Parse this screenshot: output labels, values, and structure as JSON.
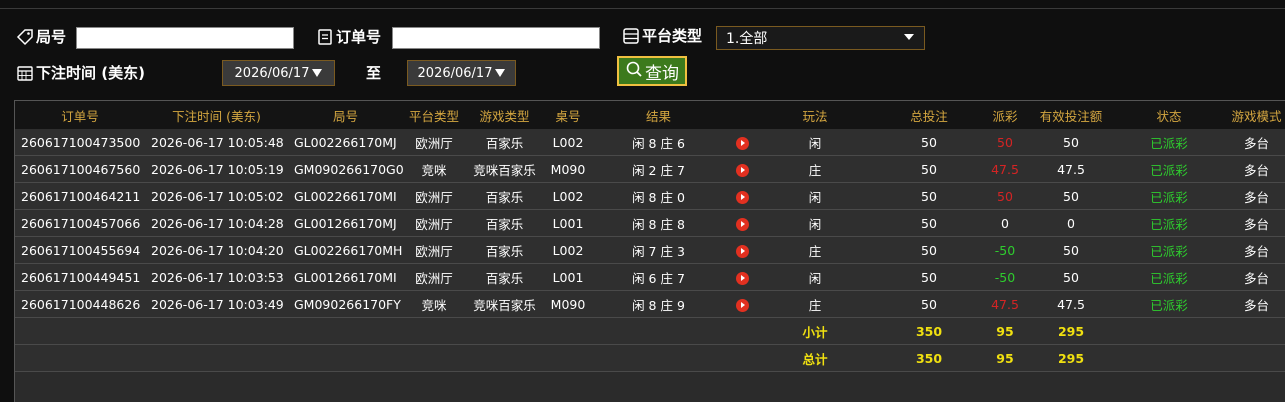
{
  "filters": {
    "ju_label": "局号",
    "ju_value": "",
    "order_label": "订单号",
    "order_value": "",
    "platform_label": "平台类型",
    "platform_selected": "1.全部",
    "bet_time_label": "下注时间 (美东)",
    "date_from": "2026/06/17",
    "to_label": "至",
    "date_to": "2026/06/17",
    "query_label": "查询"
  },
  "table": {
    "headers": [
      "订单号",
      "下注时间 (美东)",
      "局号",
      "平台类型",
      "游戏类型",
      "桌号",
      "结果",
      "",
      "玩法",
      "总投注",
      "派彩",
      "有效投注额",
      "状态",
      "游戏模式"
    ],
    "rows": [
      {
        "order": "260617100473500",
        "time": "2026-06-17 10:05:48",
        "ju": "GL002266170MJ",
        "platform": "欧洲厅",
        "game": "百家乐",
        "table_no": "L002",
        "result": "闲 8 庄 6",
        "play": "闲",
        "bet": "50",
        "payout": "50",
        "payout_color": "red",
        "valid": "50",
        "status": "已派彩",
        "mode": "多台"
      },
      {
        "order": "260617100467560",
        "time": "2026-06-17 10:05:19",
        "ju": "GM090266170G0",
        "platform": "竞咪",
        "game": "竞咪百家乐",
        "table_no": "M090",
        "result": "闲 2 庄 7",
        "play": "庄",
        "bet": "50",
        "payout": "47.5",
        "payout_color": "red",
        "valid": "47.5",
        "status": "已派彩",
        "mode": "多台"
      },
      {
        "order": "260617100464211",
        "time": "2026-06-17 10:05:02",
        "ju": "GL002266170MI",
        "platform": "欧洲厅",
        "game": "百家乐",
        "table_no": "L002",
        "result": "闲 8 庄 0",
        "play": "闲",
        "bet": "50",
        "payout": "50",
        "payout_color": "red",
        "valid": "50",
        "status": "已派彩",
        "mode": "多台"
      },
      {
        "order": "260617100457066",
        "time": "2026-06-17 10:04:28",
        "ju": "GL001266170MJ",
        "platform": "欧洲厅",
        "game": "百家乐",
        "table_no": "L001",
        "result": "闲 8 庄 8",
        "play": "闲",
        "bet": "50",
        "payout": "0",
        "payout_color": "white",
        "valid": "0",
        "status": "已派彩",
        "mode": "多台"
      },
      {
        "order": "260617100455694",
        "time": "2026-06-17 10:04:20",
        "ju": "GL002266170MH",
        "platform": "欧洲厅",
        "game": "百家乐",
        "table_no": "L002",
        "result": "闲 7 庄 3",
        "play": "庄",
        "bet": "50",
        "payout": "-50",
        "payout_color": "green",
        "valid": "50",
        "status": "已派彩",
        "mode": "多台"
      },
      {
        "order": "260617100449451",
        "time": "2026-06-17 10:03:53",
        "ju": "GL001266170MI",
        "platform": "欧洲厅",
        "game": "百家乐",
        "table_no": "L001",
        "result": "闲 6 庄 7",
        "play": "闲",
        "bet": "50",
        "payout": "-50",
        "payout_color": "green",
        "valid": "50",
        "status": "已派彩",
        "mode": "多台"
      },
      {
        "order": "260617100448626",
        "time": "2026-06-17 10:03:49",
        "ju": "GM090266170FY",
        "platform": "竞咪",
        "game": "竞咪百家乐",
        "table_no": "M090",
        "result": "闲 8 庄 9",
        "play": "庄",
        "bet": "50",
        "payout": "47.5",
        "payout_color": "red",
        "valid": "47.5",
        "status": "已派彩",
        "mode": "多台"
      }
    ],
    "subtotal": {
      "label": "小计",
      "bet": "350",
      "payout": "95",
      "valid": "295"
    },
    "total": {
      "label": "总计",
      "bet": "350",
      "payout": "95",
      "valid": "295"
    }
  },
  "colors": {
    "header_text": "#d4a640",
    "payout_red": "#d42424",
    "payout_green": "#2ecc2e",
    "status_green": "#2ecc2e",
    "sum_yellow": "#f0e010",
    "query_bg": "#3c7a1c",
    "query_border": "#f0c040"
  },
  "icons": [
    "tag-icon",
    "receipt-icon",
    "platform-list-icon",
    "calendar-icon",
    "search-icon",
    "play-icon"
  ]
}
